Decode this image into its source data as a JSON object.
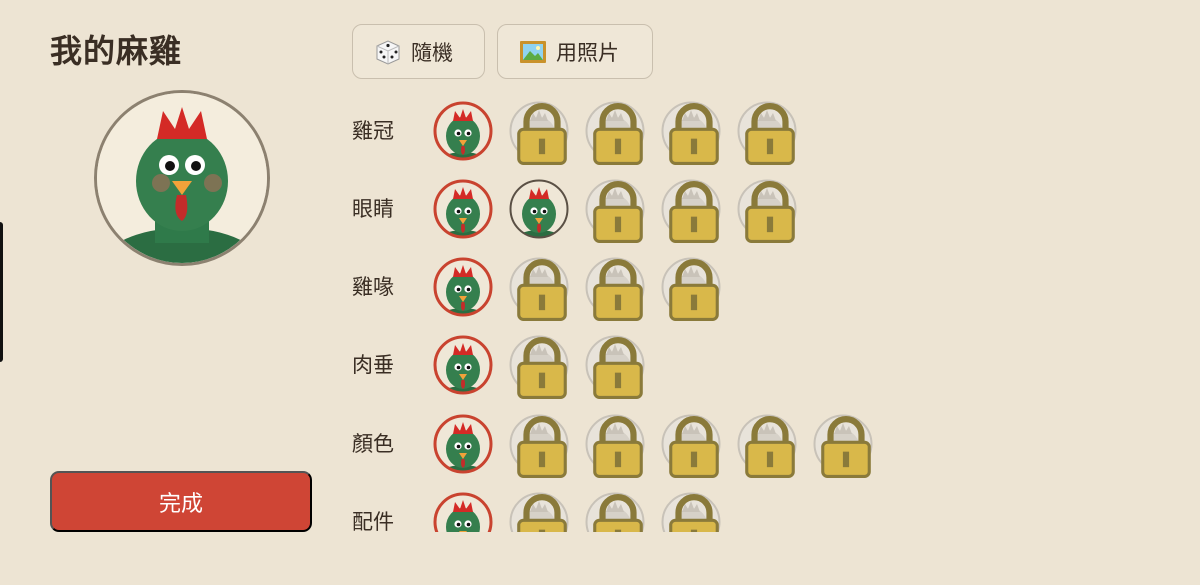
{
  "header": {
    "title": "我的麻雞"
  },
  "toolbar": {
    "random_label": "隨機",
    "photo_label": "用照片"
  },
  "footer": {
    "done_label": "完成"
  },
  "colors": {
    "accent": "#cf4535",
    "background": "#ede4d3",
    "chicken_green": "#2f7a4a"
  },
  "categories": [
    {
      "label": "雞冠",
      "options": 5,
      "selected": 0,
      "unlocked": 1
    },
    {
      "label": "眼睛",
      "options": 5,
      "selected": 0,
      "unlocked": 2
    },
    {
      "label": "雞喙",
      "options": 4,
      "selected": 0,
      "unlocked": 1
    },
    {
      "label": "肉垂",
      "options": 3,
      "selected": 0,
      "unlocked": 1
    },
    {
      "label": "顏色",
      "options": 6,
      "selected": 0,
      "unlocked": 1
    },
    {
      "label": "配件",
      "options": 4,
      "selected": 0,
      "unlocked": 1
    }
  ]
}
